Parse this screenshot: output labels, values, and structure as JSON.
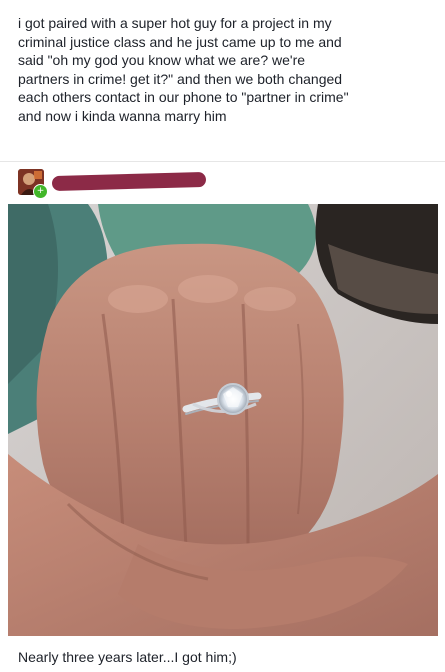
{
  "post": {
    "text": "i got paired with a super hot guy for a project in my\ncriminal justice class and he just came up to me and\nsaid \"oh my god you know what we are? we're\npartners in crime! get it?\" and then we both changed\neach others contact in our phone to \"partner in crime\"\nand now i kinda wanna marry him"
  },
  "author": {
    "avatar_icon": "profile-avatar",
    "badge_icon": "add-friend-badge-icon",
    "name_redacted": true,
    "redaction_color": "#8c2a47"
  },
  "photo": {
    "subject": "two hands in fists bumping, one wearing a diamond engagement ring"
  },
  "caption": {
    "text": "Nearly three years later...I got him;)"
  }
}
